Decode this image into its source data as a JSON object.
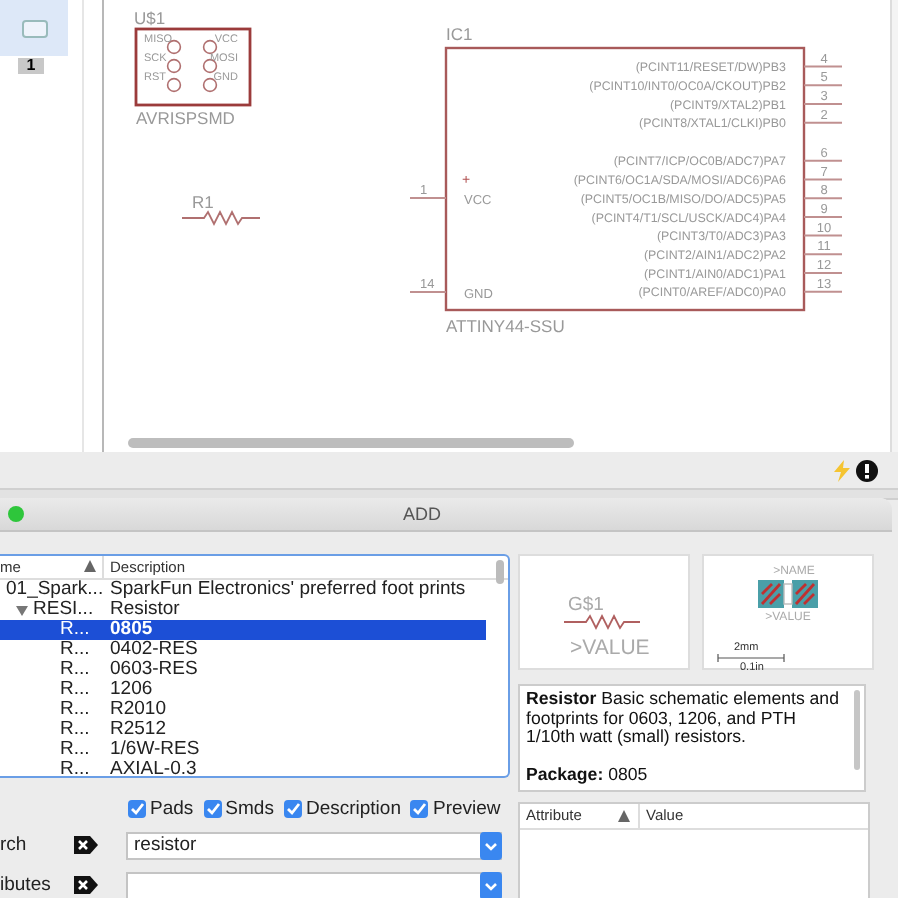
{
  "sidebar": {
    "sheets": [
      {
        "label": "1",
        "selected": true
      }
    ]
  },
  "schematic": {
    "connector": {
      "name": "U$1",
      "value": "AVRISPSMD",
      "pins_left": [
        "MISO",
        "SCK",
        "RST"
      ],
      "pins_right": [
        "VCC",
        "MOSI",
        "GND"
      ]
    },
    "resistor": {
      "name": "R1"
    },
    "ic": {
      "name": "IC1",
      "value": "ATTINY44-SSU",
      "left_pins": [
        {
          "number": "1",
          "label": "VCC",
          "mark": "+"
        },
        {
          "number": "14",
          "label": "GND"
        }
      ],
      "right_pin_groups": [
        [
          {
            "number": "4",
            "label": "(PCINT11/RESET/DW)PB3"
          },
          {
            "number": "5",
            "label": "(PCINT10/INT0/OC0A/CKOUT)PB2"
          },
          {
            "number": "3",
            "label": "(PCINT9/XTAL2)PB1"
          },
          {
            "number": "2",
            "label": "(PCINT8/XTAL1/CLKI)PB0"
          }
        ],
        [
          {
            "number": "6",
            "label": "(PCINT7/ICP/OC0B/ADC7)PA7"
          },
          {
            "number": "7",
            "label": "(PCINT6/OC1A/SDA/MOSI/ADC6)PA6"
          },
          {
            "number": "8",
            "label": "(PCINT5/OC1B/MISO/DO/ADC5)PA5"
          },
          {
            "number": "9",
            "label": "(PCINT4/T1/SCL/USCK/ADC4)PA4"
          },
          {
            "number": "10",
            "label": "(PCINT3/T0/ADC3)PA3"
          },
          {
            "number": "11",
            "label": "(PCINT2/AIN1/ADC2)PA2"
          },
          {
            "number": "12",
            "label": "(PCINT1/AIN0/ADC1)PA1"
          },
          {
            "number": "13",
            "label": "(PCINT0/AREF/ADC0)PA0"
          }
        ]
      ]
    }
  },
  "dialog": {
    "title": "ADD",
    "tree": {
      "columns": [
        "me",
        "Description"
      ],
      "rows": [
        {
          "name": "01_Spark...",
          "description": "SparkFun Electronics' preferred foot prints",
          "selected": false,
          "children": [
            {
              "name": "RESI...",
              "description": "Resistor",
              "selected": false,
              "expanded": true,
              "children": [
                {
                  "name": "R...",
                  "description": "0805",
                  "selected": true
                },
                {
                  "name": "R...",
                  "description": "0402-RES",
                  "selected": false
                },
                {
                  "name": "R...",
                  "description": "0603-RES",
                  "selected": false
                },
                {
                  "name": "R...",
                  "description": "1206",
                  "selected": false
                },
                {
                  "name": "R...",
                  "description": "R2010",
                  "selected": false
                },
                {
                  "name": "R...",
                  "description": "R2512",
                  "selected": false
                },
                {
                  "name": "R...",
                  "description": "1/6W-RES",
                  "selected": false
                },
                {
                  "name": "R...",
                  "description": "AXIAL-0.3",
                  "selected": false
                }
              ]
            }
          ]
        }
      ]
    },
    "filters": [
      {
        "label": "Pads",
        "checked": true
      },
      {
        "label": "Smds",
        "checked": true
      },
      {
        "label": "Description",
        "checked": true
      },
      {
        "label": "Preview",
        "checked": true
      }
    ],
    "search": {
      "label": "rch",
      "value": "resistor"
    },
    "attributes_filter": {
      "label": "ibutes"
    },
    "symbol_preview": {
      "name": "G$1",
      "value": ">VALUE"
    },
    "package_preview": {
      "name": ">NAME",
      "value": ">VALUE",
      "scale_top": "2mm",
      "scale_bottom": "0.1in"
    },
    "description": {
      "paragraphs": [
        "**Resistor** Basic schematic elements and footprints for 0603, 1206, and PTH 1/10th watt (small) resistors.",
        "**Package:** 0805"
      ]
    },
    "attribute_table": {
      "columns": [
        "Attribute",
        "Value"
      ]
    }
  }
}
